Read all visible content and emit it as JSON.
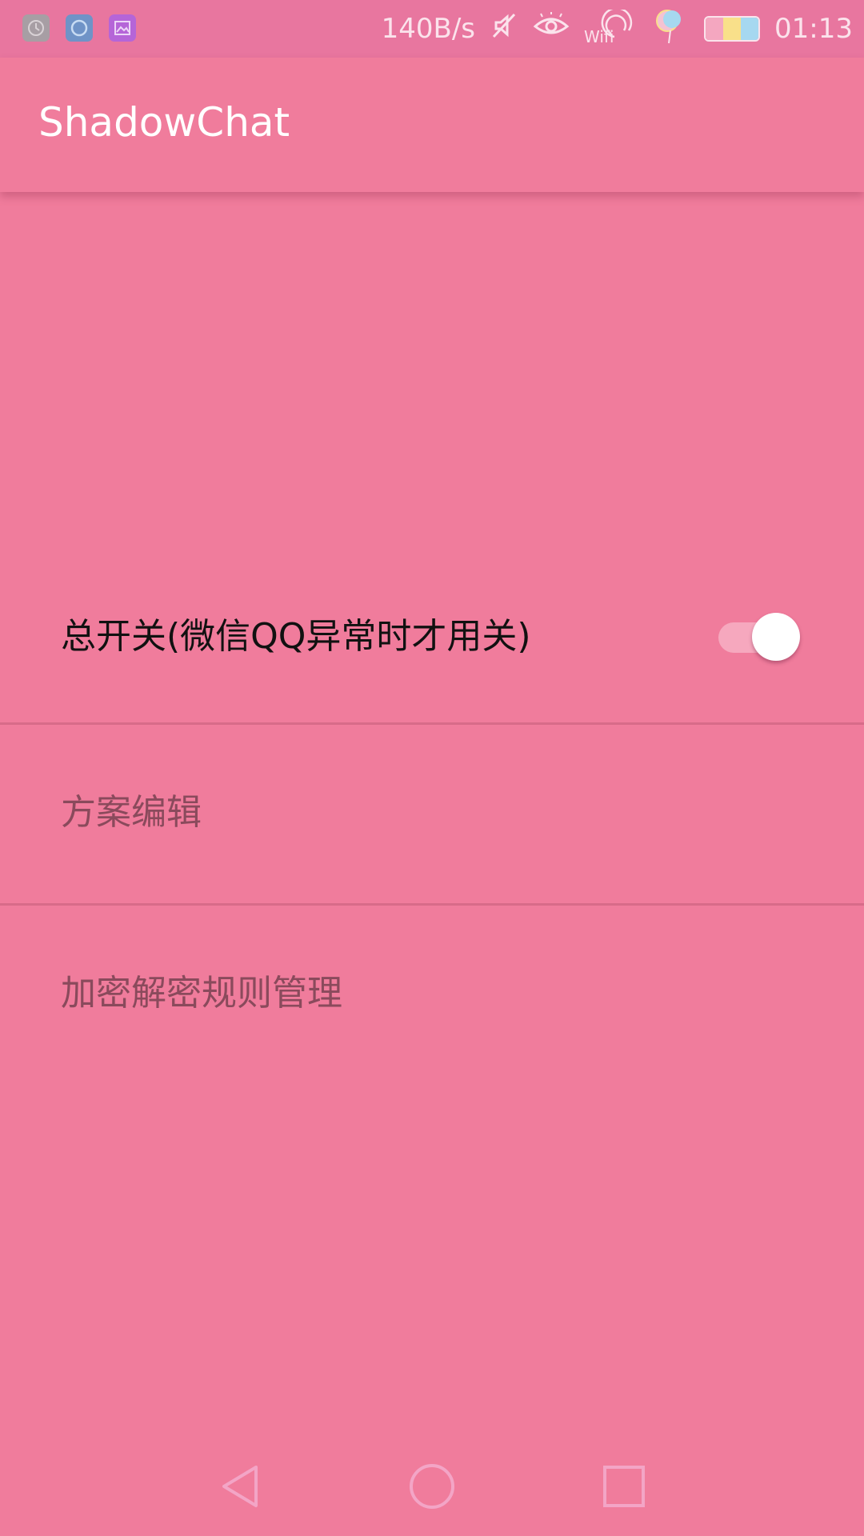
{
  "status_bar": {
    "notification_icons": [
      "clock-app-icon",
      "circle-app-icon",
      "gallery-app-icon"
    ],
    "net_speed": "140B/s",
    "wifi_label": "Wifi",
    "time": "01:13"
  },
  "app_bar": {
    "title": "ShadowChat"
  },
  "settings": {
    "master_switch": {
      "label": "总开关(微信QQ异常时才用关)",
      "checked": true
    },
    "scheme_edit": {
      "label": "方案编辑"
    },
    "rules_manage": {
      "label": "加密解密规则管理"
    }
  },
  "colors": {
    "background": "#f07c9c",
    "status_bar": "#e8769f",
    "divider": "#d86b89",
    "nav_icon": "#f3a5c6"
  }
}
